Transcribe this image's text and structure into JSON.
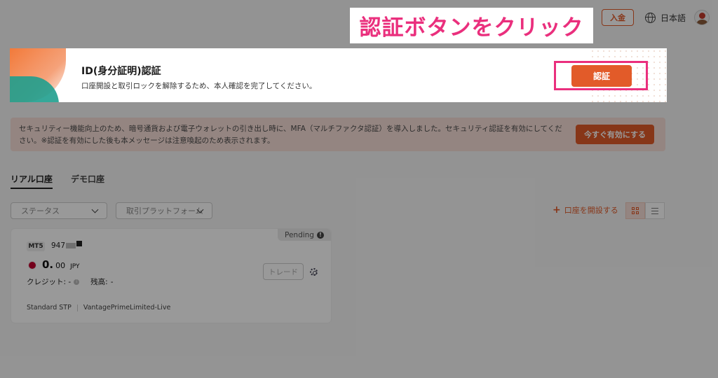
{
  "header": {
    "deposit_label": "入金",
    "language_label": "日本語"
  },
  "caption": {
    "text": "認証ボタンをクリック",
    "color": "#ea2f7d"
  },
  "verification": {
    "title": "ID(身分証明)認証",
    "subtitle": "口座開設と取引ロックを解除するため、本人確認を完了してください。",
    "button_label": "認証"
  },
  "mfa_notice": {
    "text": "セキュリティー機能向上のため、暗号通貨および電子ウォレットの引き出し時に、MFA（マルチファクタ認証）を導入しました。セキュリティ認証を有効にしてください。※認証を有効にした後も本メッセージは注意喚起のため表示されます。",
    "button_label": "今すぐ有効にする"
  },
  "tabs": [
    {
      "label": "リアル口座",
      "active": true
    },
    {
      "label": "デモ口座",
      "active": false
    }
  ],
  "filters": {
    "status_placeholder": "ステータス",
    "platform_placeholder": "取引プラットフォーム"
  },
  "actions": {
    "open_account_label": "口座を開設する"
  },
  "account": {
    "status": "Pending",
    "platform": "MT5",
    "number_visible": "947",
    "balance_int": "0.",
    "balance_dec": "00",
    "currency": "JPY",
    "credit_label": "クレジット: -",
    "equity_label": "残高:",
    "equity_value": "-",
    "trade_label": "トレード",
    "account_type": "Standard STP",
    "server": "VantagePrimeLimited-Live"
  },
  "colors": {
    "accent": "#e25b29",
    "highlight": "#ea2f7d",
    "notice_bg": "#f7ded7"
  }
}
